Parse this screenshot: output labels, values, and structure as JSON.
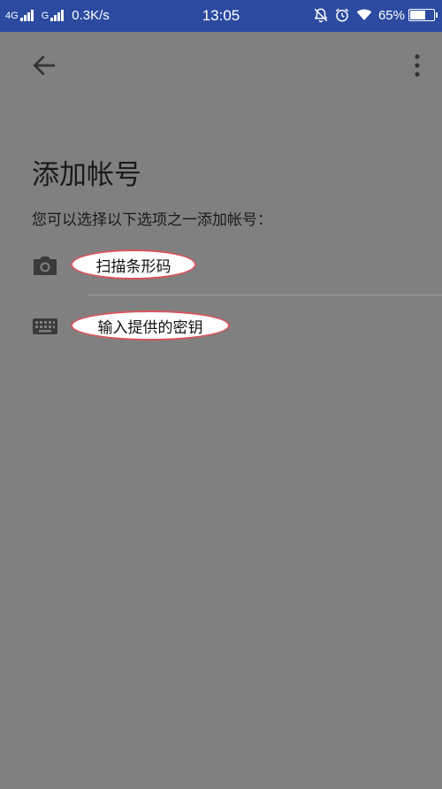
{
  "status_bar": {
    "network_1": "4G",
    "network_2": "G",
    "speed": "0.3K/s",
    "time": "13:05",
    "battery_percent": "65%",
    "battery_level": 0.65,
    "icons": [
      "mute-bell-icon",
      "alarm-icon",
      "wifi-icon",
      "battery-icon"
    ]
  },
  "toolbar": {
    "back_icon": "arrow-left-icon",
    "menu_icon": "more-vertical-icon"
  },
  "page": {
    "title": "添加帐号",
    "subtitle": "您可以选择以下选项之一添加帐号："
  },
  "options": [
    {
      "label": "扫描条形码",
      "icon": "camera-icon"
    },
    {
      "label": "输入提供的密钥",
      "icon": "keyboard-icon"
    }
  ],
  "colors": {
    "status_bar_bg": "#2b4aa0",
    "page_bg": "#808080",
    "highlight_border": "#d9535c"
  }
}
